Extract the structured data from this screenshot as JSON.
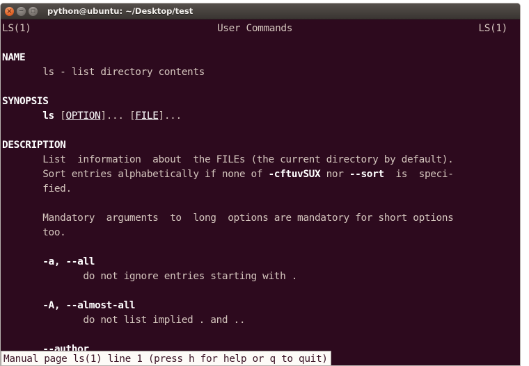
{
  "window": {
    "title": "python@ubuntu: ~/Desktop/test",
    "buttons": {
      "close_label": "×",
      "minimize_label": "−",
      "maximize_label": "□"
    }
  },
  "man_page": {
    "header": {
      "left": "LS(1)",
      "center": "User Commands",
      "right": "LS(1)"
    },
    "lines": [
      {
        "id": "blank-1",
        "type": "blank",
        "text": " "
      },
      {
        "id": "name-heading",
        "type": "section",
        "text": "NAME"
      },
      {
        "id": "name-body",
        "type": "text",
        "text": "       ls - list directory contents"
      },
      {
        "id": "blank-2",
        "type": "blank",
        "text": " "
      },
      {
        "id": "synopsis-heading",
        "type": "section",
        "text": "SYNOPSIS"
      },
      {
        "id": "synopsis-body",
        "type": "markup",
        "text": "       ls [OPTION]... [FILE]..."
      },
      {
        "id": "blank-3",
        "type": "blank",
        "text": " "
      },
      {
        "id": "description-heading",
        "type": "section",
        "text": "DESCRIPTION"
      },
      {
        "id": "desc-line-1",
        "type": "text",
        "text": "       List  information  about  the FILEs (the current directory by default)."
      },
      {
        "id": "desc-line-2",
        "type": "markup",
        "text": "       Sort entries alphabetically if none of -cftuvSUX nor --sort  is  speci-"
      },
      {
        "id": "desc-line-3",
        "type": "text",
        "text": "       fied."
      },
      {
        "id": "blank-4",
        "type": "blank",
        "text": " "
      },
      {
        "id": "mandatory-line-1",
        "type": "text",
        "text": "       Mandatory  arguments  to  long  options are mandatory for short options"
      },
      {
        "id": "mandatory-line-2",
        "type": "text",
        "text": "       too."
      },
      {
        "id": "blank-5",
        "type": "blank",
        "text": " "
      },
      {
        "id": "opt-a-term",
        "type": "markup",
        "text": "       -a, --all"
      },
      {
        "id": "opt-a-desc",
        "type": "text",
        "text": "              do not ignore entries starting with ."
      },
      {
        "id": "blank-6",
        "type": "blank",
        "text": " "
      },
      {
        "id": "opt-A-term",
        "type": "markup",
        "text": "       -A, --almost-all"
      },
      {
        "id": "opt-A-desc",
        "type": "text",
        "text": "              do not list implied . and .."
      },
      {
        "id": "blank-7",
        "type": "blank",
        "text": " "
      },
      {
        "id": "opt-author-term",
        "type": "markup",
        "text": "       --author"
      }
    ],
    "synopsis_parts": {
      "indent": "       ",
      "command": "ls",
      "space1": " [",
      "option": "OPTION",
      "between": "]... [",
      "file": "FILE",
      "tail": "]..."
    },
    "desc_line2_parts": {
      "pre": "       Sort entries alphabetically if none of ",
      "bold1": "-cftuvSUX",
      "mid": " nor ",
      "bold2": "--sort",
      "post": "  is  speci-"
    },
    "opt_a_parts": {
      "indent": "       ",
      "flags": "-a, --all"
    },
    "opt_A_parts": {
      "indent": "       ",
      "flags": "-A, --almost-all"
    },
    "opt_author_parts": {
      "indent": "       ",
      "flags": "--author"
    }
  },
  "status_bar": {
    "text": "Manual page ls(1) line 1 (press h for help or q to quit)"
  },
  "colors": {
    "terminal_background": "#2d0a1e",
    "body_text": "#d4c5bd",
    "bold_text": "#ffffff",
    "titlebar_background": "#46413d",
    "status_background": "#fdfbf7",
    "status_text": "#3b1426",
    "close_button": "#e2672a"
  }
}
